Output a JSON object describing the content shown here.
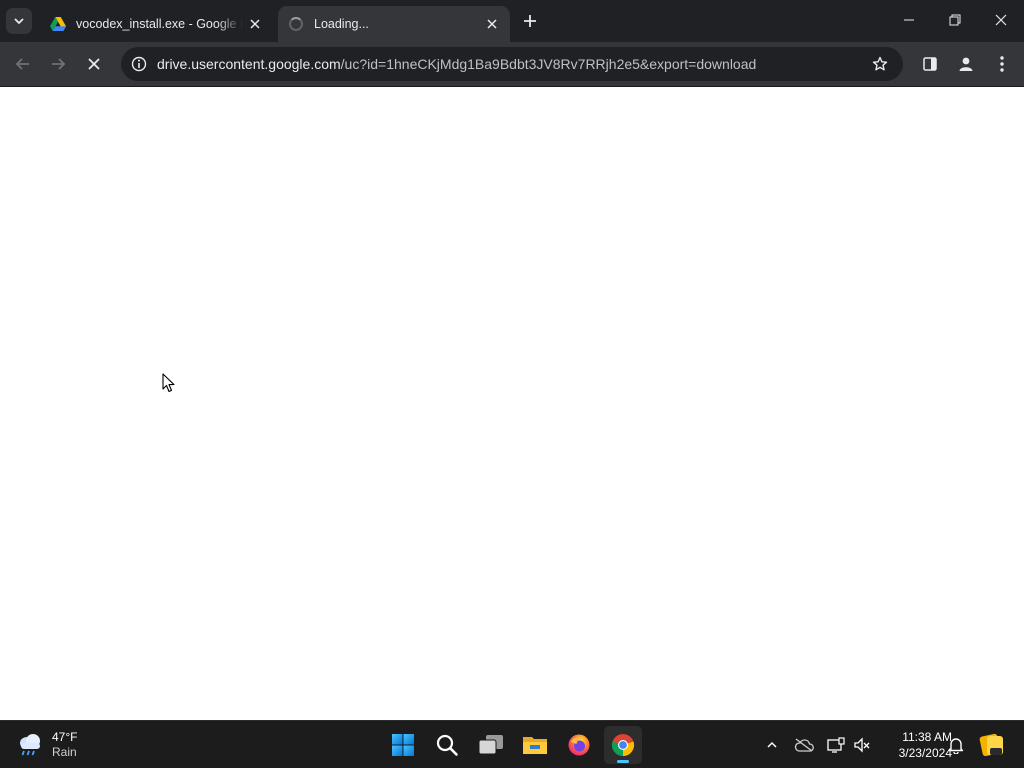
{
  "browser": {
    "tabs": [
      {
        "title": "vocodex_install.exe - Google Drive",
        "favicon": "google-drive-icon",
        "active": false
      },
      {
        "title": "Loading...",
        "favicon": "loading-spinner-icon",
        "active": true
      }
    ],
    "address_bar": {
      "host": "drive.usercontent.google.com",
      "path": "/uc?id=1hneCKjMdg1Ba9Bdbt3JV8Rv7RRjh2e5&export=download"
    }
  },
  "taskbar": {
    "weather": {
      "temperature": "47°F",
      "condition": "Rain"
    },
    "apps": [
      "start-icon",
      "search-icon",
      "task-view-icon",
      "file-explorer-icon",
      "firefox-icon",
      "chrome-icon"
    ],
    "clock": {
      "time": "11:38 AM",
      "date": "3/23/2024"
    }
  },
  "colors": {
    "titlebar": "#202124",
    "toolbar": "#35363a",
    "page_background": "#ffffff",
    "taskbar": "#1c1c1c",
    "taskbar_active_indicator": "#4cc2ff"
  }
}
